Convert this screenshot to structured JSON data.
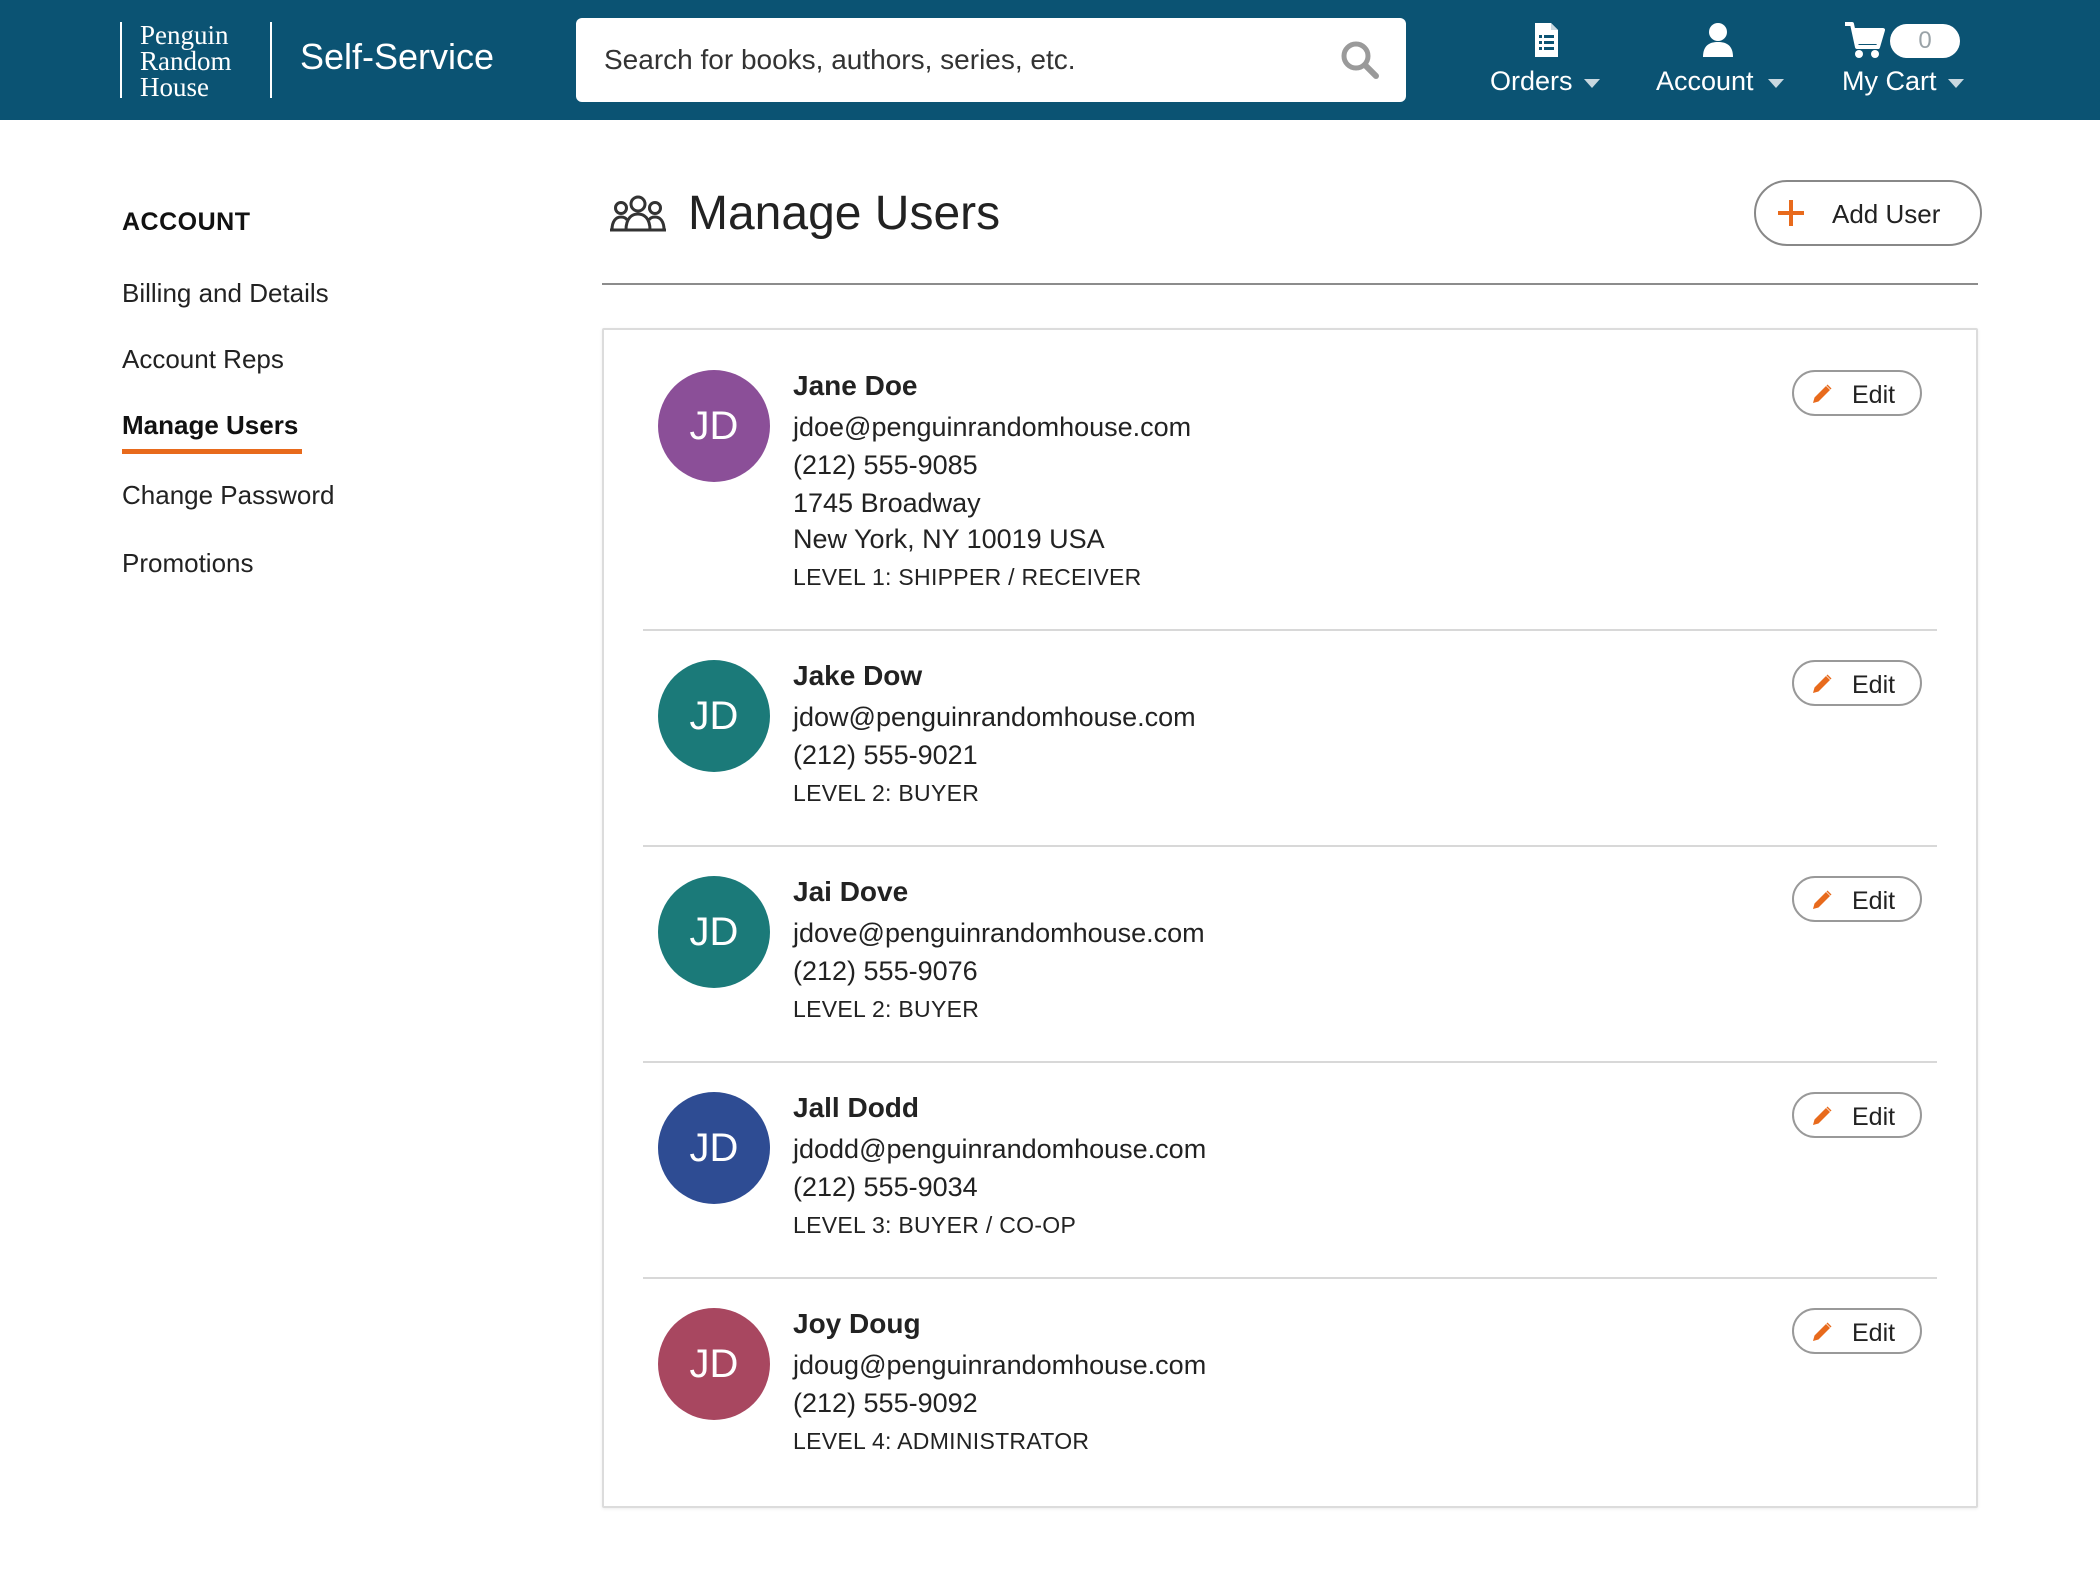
{
  "header": {
    "logo_lines": [
      "Penguin",
      "Random",
      "House"
    ],
    "app_name": "Self-Service",
    "search_placeholder": "Search for books, authors, series, etc.",
    "nav": {
      "orders": "Orders",
      "account": "Account",
      "cart": "My Cart",
      "cart_count": "0"
    }
  },
  "sidebar": {
    "heading": "ACCOUNT",
    "items": [
      {
        "label": "Billing and Details"
      },
      {
        "label": "Account Reps"
      },
      {
        "label": "Manage Users",
        "active": true
      },
      {
        "label": "Change Password"
      },
      {
        "label": "Promotions"
      }
    ]
  },
  "main": {
    "title": "Manage Users",
    "add_user_label": "Add User",
    "edit_label": "Edit",
    "users": [
      {
        "initials": "JD",
        "name": "Jane Doe",
        "email": "jdoe@penguinrandomhouse.com",
        "phone": "(212) 555-9085",
        "address_line1": "1745 Broadway",
        "address_line2": "New York, NY 10019 USA",
        "level": "LEVEL 1: SHIPPER / RECEIVER",
        "avatar_color": "#8b4f98"
      },
      {
        "initials": "JD",
        "name": "Jake Dow",
        "email": "jdow@penguinrandomhouse.com",
        "phone": "(212) 555-9021",
        "level": "LEVEL 2: BUYER",
        "avatar_color": "#1b7a79"
      },
      {
        "initials": "JD",
        "name": "Jai Dove",
        "email": "jdove@penguinrandomhouse.com",
        "phone": "(212) 555-9076",
        "level": "LEVEL 2: BUYER",
        "avatar_color": "#1b7a79"
      },
      {
        "initials": "JD",
        "name": "Jall Dodd",
        "email": "jdodd@penguinrandomhouse.com",
        "phone": "(212) 555-9034",
        "level": "LEVEL 3: BUYER / CO-OP",
        "avatar_color": "#2e4c93"
      },
      {
        "initials": "JD",
        "name": "Joy Doug",
        "email": "jdoug@penguinrandomhouse.com",
        "phone": "(212) 555-9092",
        "level": "LEVEL 4: ADMINISTRATOR",
        "avatar_color": "#a84760"
      }
    ]
  },
  "colors": {
    "header_bg": "#0b5373",
    "accent": "#e86a1c"
  },
  "icons": [
    "search-icon",
    "orders-document-icon",
    "account-person-icon",
    "cart-icon",
    "chevron-down-icon",
    "users-group-icon",
    "plus-icon",
    "pencil-icon"
  ]
}
